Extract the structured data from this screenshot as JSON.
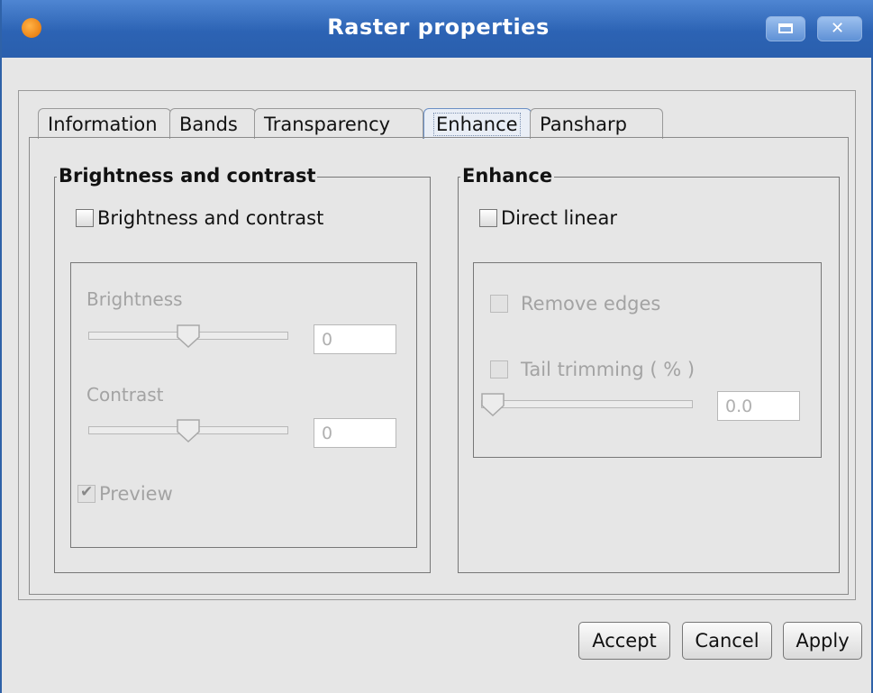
{
  "window": {
    "title": "Raster properties",
    "icons": {
      "app": "app-orange-icon",
      "maximize": "maximize-icon",
      "close": "close-icon"
    }
  },
  "tabs": [
    {
      "label": "Information",
      "active": false
    },
    {
      "label": "Bands",
      "active": false
    },
    {
      "label": "Transparency",
      "active": false
    },
    {
      "label": "Enhance",
      "active": true
    },
    {
      "label": "Pansharp",
      "active": false
    }
  ],
  "brightness_group": {
    "title": "Brightness and contrast",
    "enable_checkbox": {
      "label": "Brightness and contrast",
      "checked": false
    },
    "brightness": {
      "label": "Brightness",
      "value": "0"
    },
    "contrast": {
      "label": "Contrast",
      "value": "0"
    },
    "preview": {
      "label": "Preview",
      "checked": true,
      "disabled": true
    }
  },
  "enhance_group": {
    "title": "Enhance",
    "direct_linear": {
      "label": "Direct linear",
      "checked": false
    },
    "remove_edges": {
      "label": "Remove edges",
      "checked": false,
      "disabled": true
    },
    "tail_trimming": {
      "label": "Tail trimming ( % )",
      "checked": false,
      "disabled": true,
      "value": "0.0"
    }
  },
  "buttons": {
    "accept": "Accept",
    "cancel": "Cancel",
    "apply": "Apply"
  },
  "colors": {
    "titlebar": "#2c63b4",
    "accent": "#4f86d2"
  }
}
